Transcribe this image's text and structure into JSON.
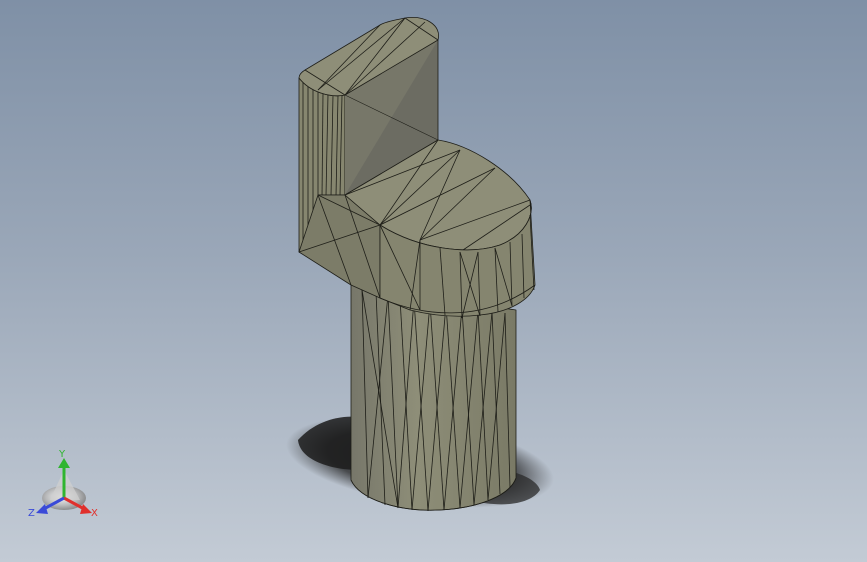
{
  "viewport": {
    "background_top": "#7f90a6",
    "background_bottom": "#c3cbd5",
    "model_color": "#8e8e78",
    "edge_color": "#1e1e18"
  },
  "triad": {
    "x_label": "X",
    "y_label": "Y",
    "z_label": "Z",
    "x_color": "#e0302c",
    "y_color": "#2fb52f",
    "z_color": "#3a4ad8"
  }
}
